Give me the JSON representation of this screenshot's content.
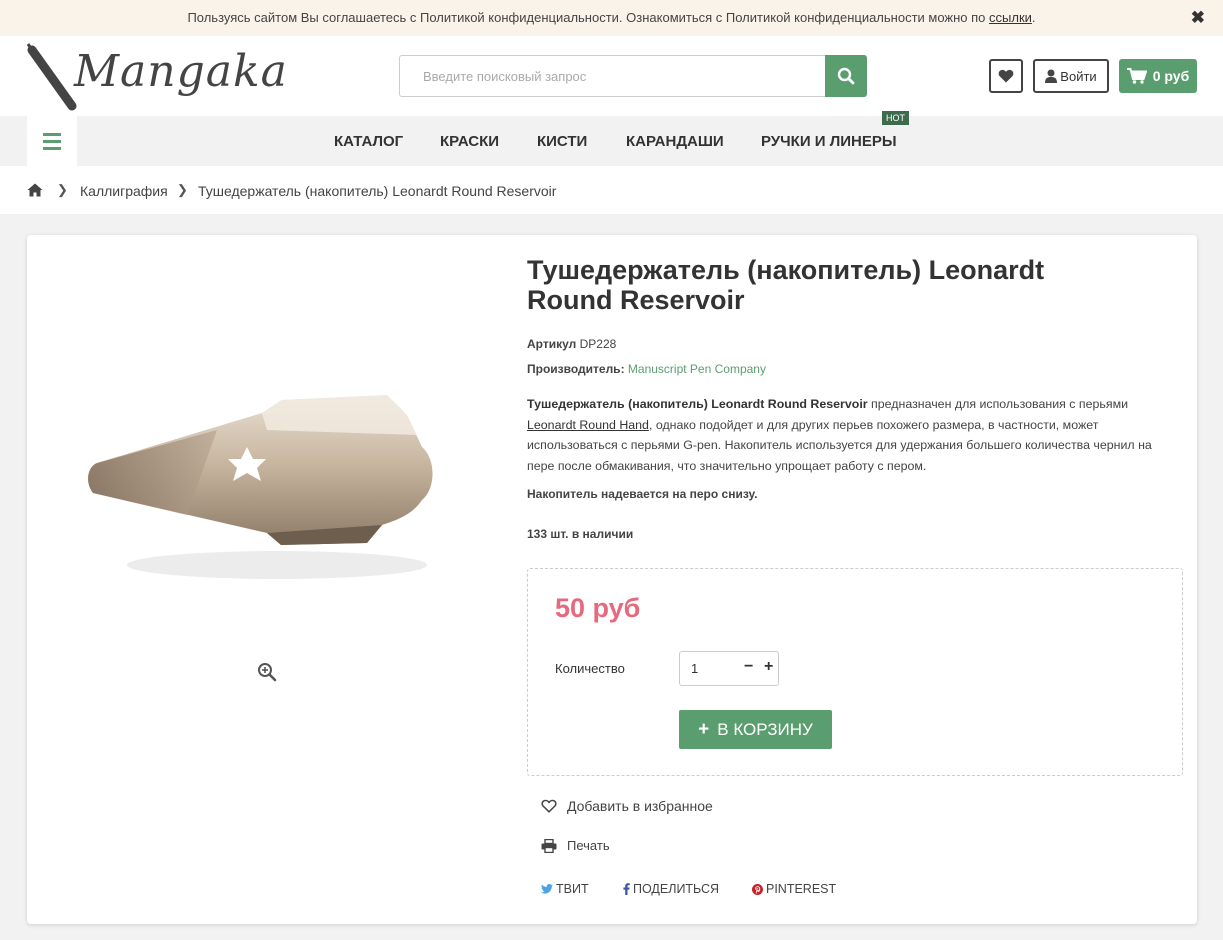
{
  "cookie": {
    "text": "Пользуясь сайтом Вы соглашаетесь с Политикой конфиденциальности. Ознакомиться с Политикой конфиденциальности можно по ",
    "link": "ссылки",
    "end": ".",
    "close": "✖"
  },
  "header": {
    "logo": "Mangaka",
    "search_placeholder": "Введите поисковый запрос",
    "login": "Войти",
    "cart": "0 руб"
  },
  "nav": {
    "items": [
      "КАТАЛОГ",
      "КРАСКИ",
      "КИСТИ",
      "КАРАНДАШИ",
      "РУЧКИ И ЛИНЕРЫ"
    ],
    "hot_badge": "HOT"
  },
  "breadcrumb": {
    "items": [
      "Каллиграфия",
      "Тушедержатель (накопитель) Leonardt Round Reservoir"
    ]
  },
  "product": {
    "title": "Тушедержатель (накопитель) Leonardt Round Reservoir",
    "sku_label": "Артикул",
    "sku": "DP228",
    "maker_label": "Производитель:",
    "maker": "Manuscript Pen Company",
    "desc_bold": "Тушедержатель (накопитель) Leonardt Round Reservoir",
    "desc_1": " предназначен для использования с перьями ",
    "desc_link": "Leonardt Round Hand",
    "desc_2": ", однако подойдет и для других перьев похожего размера, в частности, может использоваться с перьями G-pen. Накопитель используется для удержания большего количества чернил на пере после обмакивания, что значительно упрощает работу с пером.",
    "note": "Накопитель надевается на перо снизу.",
    "stock": "133 шт. в наличии",
    "price": "50 руб",
    "qty_label": "Количество",
    "qty": "1",
    "add_to_cart": "В КОРЗИНУ",
    "favorite": "Добавить в избранное",
    "print": "Печать",
    "share": {
      "twitter": "ТВИТ",
      "facebook": "ПОДЕЛИТЬСЯ",
      "pinterest": "PINTEREST"
    }
  },
  "colors": {
    "accent": "#5a9e6f",
    "price": "#e66a7e",
    "cookie_bg": "#faf3ea"
  }
}
